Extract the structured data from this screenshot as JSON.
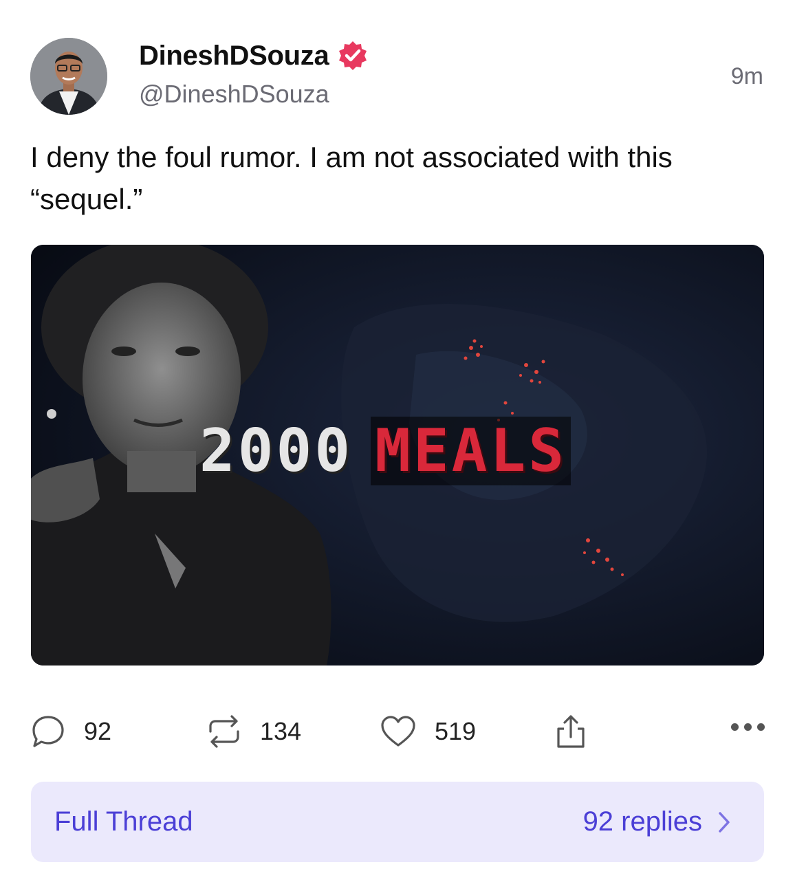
{
  "post": {
    "author_name": "DineshDSouza",
    "author_handle": "@DineshDSouza",
    "time": "9m",
    "text": "I deny the foul rumor. I am not associated with this “sequel.”",
    "verified": true,
    "verified_color": "#e8395f"
  },
  "media": {
    "title_number": "2000",
    "title_word": "MEALS",
    "word_color": "#d9283a"
  },
  "actions": {
    "replies": "92",
    "reposts": "134",
    "likes": "519"
  },
  "thread": {
    "label": "Full Thread",
    "replies_text": "92 replies",
    "accent": "#4b3fd6"
  }
}
